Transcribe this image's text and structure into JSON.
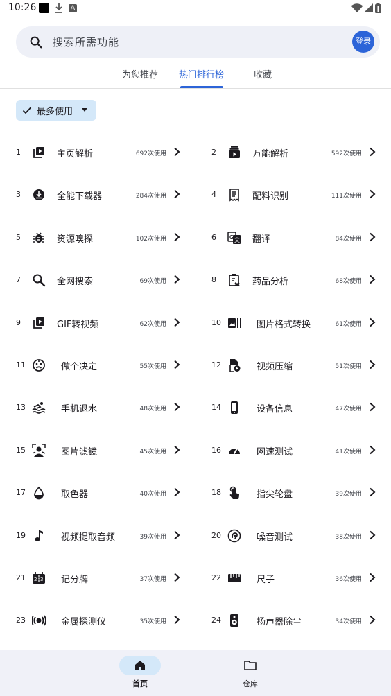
{
  "status_bar": {
    "time": "10:26"
  },
  "search": {
    "placeholder": "搜索所需功能",
    "login_label": "登录"
  },
  "tabs": [
    {
      "label": "为您推荐",
      "active": false
    },
    {
      "label": "热门排行榜",
      "active": true
    },
    {
      "label": "收藏",
      "active": false
    }
  ],
  "filter": {
    "label": "最多使用"
  },
  "ranking": [
    {
      "rank": "1",
      "name": "主页解析",
      "count": "692次使用",
      "icon": "play-stack-icon"
    },
    {
      "rank": "2",
      "name": "万能解析",
      "count": "592次使用",
      "icon": "video-library-icon"
    },
    {
      "rank": "3",
      "name": "全能下载器",
      "count": "284次使用",
      "icon": "download-circle-icon"
    },
    {
      "rank": "4",
      "name": "配料识别",
      "count": "111次使用",
      "icon": "receipt-icon"
    },
    {
      "rank": "5",
      "name": "资源嗅探",
      "count": "102次使用",
      "icon": "bug-icon"
    },
    {
      "rank": "6",
      "name": "翻译",
      "count": "84次使用",
      "icon": "translate-icon"
    },
    {
      "rank": "7",
      "name": "全网搜索",
      "count": "69次使用",
      "icon": "search-icon"
    },
    {
      "rank": "8",
      "name": "药品分析",
      "count": "68次使用",
      "icon": "medical-clipboard-icon"
    },
    {
      "rank": "9",
      "name": "GIF转视频",
      "count": "62次使用",
      "icon": "play-stack-icon"
    },
    {
      "rank": "10",
      "name": "图片格式转换",
      "count": "61次使用",
      "icon": "image-stack-icon"
    },
    {
      "rank": "11",
      "name": "做个决定",
      "count": "55次使用",
      "icon": "dice-face-icon"
    },
    {
      "rank": "12",
      "name": "视频压缩",
      "count": "51次使用",
      "icon": "video-file-icon"
    },
    {
      "rank": "13",
      "name": "手机退水",
      "count": "48次使用",
      "icon": "swim-water-icon"
    },
    {
      "rank": "14",
      "name": "设备信息",
      "count": "47次使用",
      "icon": "smartphone-icon"
    },
    {
      "rank": "15",
      "name": "图片滤镜",
      "count": "45次使用",
      "icon": "filter-person-icon"
    },
    {
      "rank": "16",
      "name": "网速测试",
      "count": "41次使用",
      "icon": "speedometer-icon"
    },
    {
      "rank": "17",
      "name": "取色器",
      "count": "40次使用",
      "icon": "color-drop-icon"
    },
    {
      "rank": "18",
      "name": "指尖轮盘",
      "count": "39次使用",
      "icon": "touch-finger-icon"
    },
    {
      "rank": "19",
      "name": "视频提取音频",
      "count": "39次使用",
      "icon": "music-note-icon"
    },
    {
      "rank": "20",
      "name": "噪音测试",
      "count": "38次使用",
      "icon": "ear-icon"
    },
    {
      "rank": "21",
      "name": "记分牌",
      "count": "37次使用",
      "icon": "scoreboard-icon"
    },
    {
      "rank": "22",
      "name": "尺子",
      "count": "36次使用",
      "icon": "ruler-icon"
    },
    {
      "rank": "23",
      "name": "金属探测仪",
      "count": "35次使用",
      "icon": "sensor-icon"
    },
    {
      "rank": "24",
      "name": "扬声器除尘",
      "count": "34次使用",
      "icon": "speaker-icon"
    }
  ],
  "bottom_nav": [
    {
      "label": "首页",
      "icon": "home-icon",
      "active": true
    },
    {
      "label": "仓库",
      "icon": "folder-icon",
      "active": false
    }
  ],
  "colors": {
    "accent": "#2c64d8",
    "chip_bg": "#d4e8f9",
    "search_bg": "#eef0f7",
    "nav_bg": "#f0f1f8"
  }
}
